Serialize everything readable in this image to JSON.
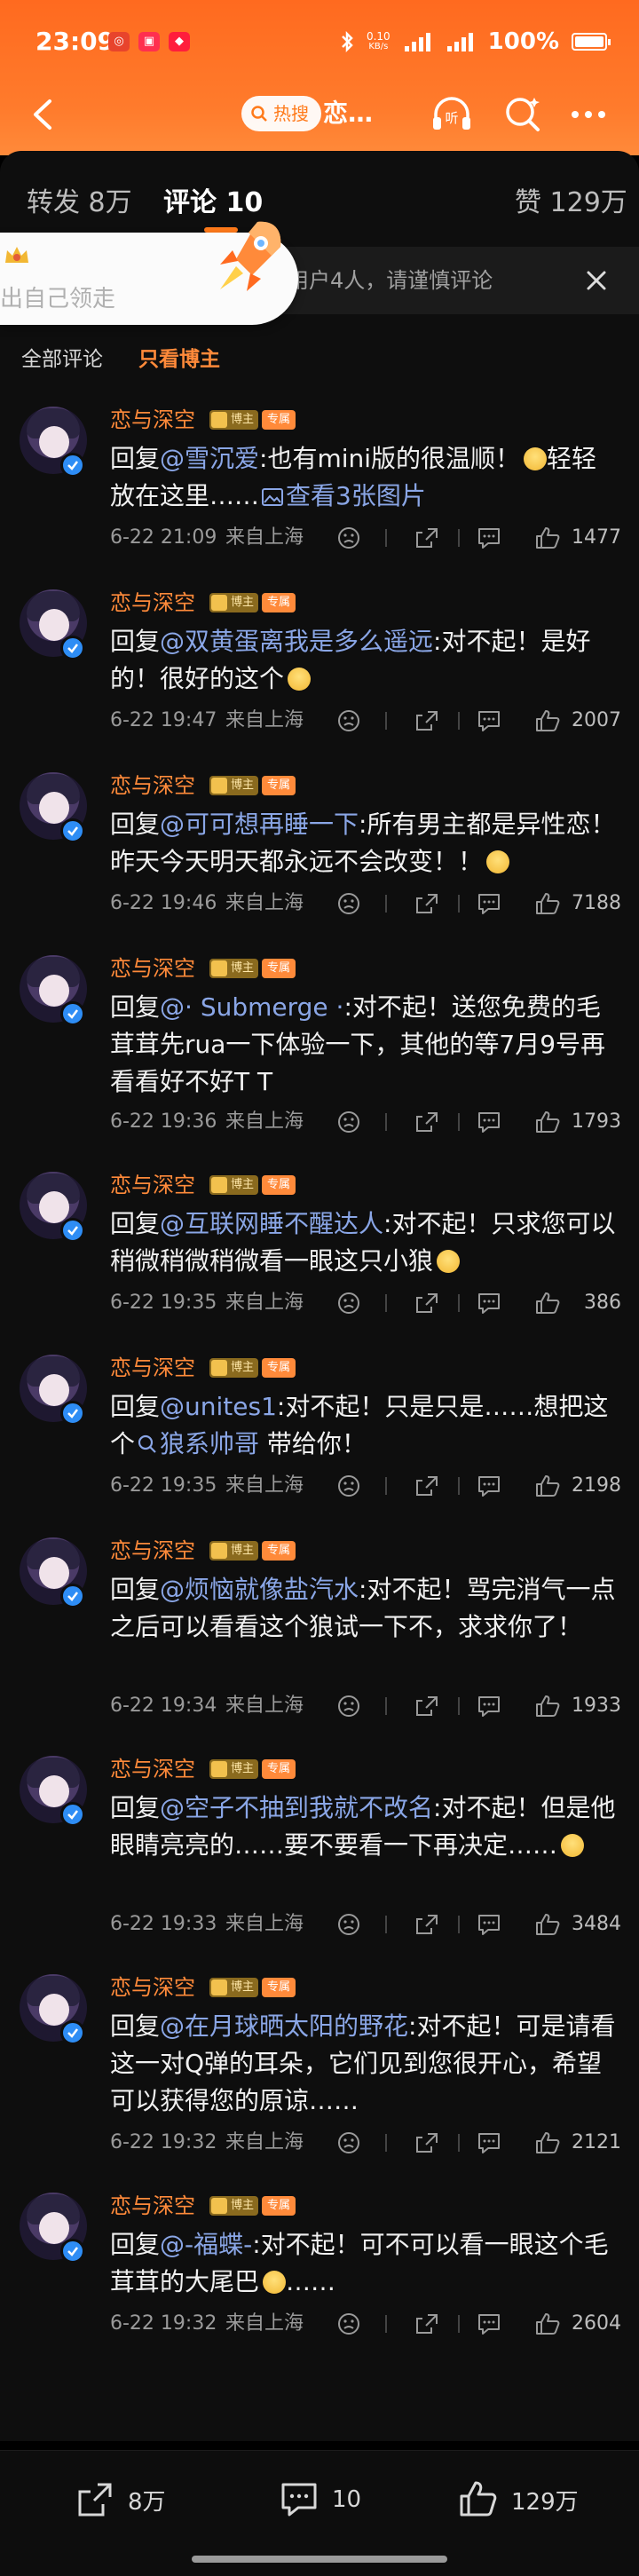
{
  "status_bar": {
    "time": "23:09",
    "net_speed_value": "0.10",
    "net_speed_unit": "KB/s",
    "signal1": "5G",
    "signal2": "5G",
    "battery": "100%"
  },
  "nav": {
    "hot_badge": "热搜",
    "topic": "恋…"
  },
  "tabs": {
    "repost": "转发 8万",
    "comments": "评论 10",
    "likes": "赞 129万"
  },
  "notice": {
    "text": "论用户4人，请谨慎评论"
  },
  "promo": {
    "text": "出自己领走"
  },
  "filters": {
    "all": "全部评论",
    "owner_only": "只看博主"
  },
  "labels": {
    "reply_prefix": "回复",
    "location": "来自上海",
    "badge_boss": "博主",
    "badge_fan": "专属"
  },
  "comments": [
    {
      "user": "恋与深空",
      "mention": "@雪沉爱",
      "text": ":也有mini版的很温顺！",
      "text2": "轻轻放在这里……",
      "pic_link": "查看3张图片",
      "date": "6-22 21:09",
      "likes": "1477"
    },
    {
      "user": "恋与深空",
      "mention": "@双黄蛋离我是多么遥远",
      "text": ":对不起！是好的！很好的这个",
      "date": "6-22 19:47",
      "likes": "2007"
    },
    {
      "user": "恋与深空",
      "mention": "@可可想再睡一下",
      "text": ":所有男主都是异性恋！昨天今天明天都永远不会改变！！",
      "date": "6-22 19:46",
      "likes": "7188"
    },
    {
      "user": "恋与深空",
      "mention": "@· Submerge ·",
      "text": ":对不起！送您免费的毛茸茸先rua一下体验一下，其他的等7月9号再看看好不好T T",
      "date": "6-22 19:36",
      "likes": "1793"
    },
    {
      "user": "恋与深空",
      "mention": "@互联网睡不醒达人",
      "text": ":对不起！只求您可以稍微稍微稍微看一眼这只小狼",
      "date": "6-22 19:35",
      "likes": "386"
    },
    {
      "user": "恋与深空",
      "mention": "@unites1",
      "text": ":对不起！只是只是……想把这个",
      "search_link": "狼系帅哥",
      "text2": " 带给你！",
      "date": "6-22 19:35",
      "likes": "2198"
    },
    {
      "user": "恋与深空",
      "mention": "@烦恼就像盐汽水",
      "text": ":对不起！骂完消气一点之后可以看看这个狼试一下不，求求你了！",
      "date": "6-22 19:34",
      "likes": "1933"
    },
    {
      "user": "恋与深空",
      "mention": "@空子不抽到我就不改名",
      "text": ":对不起！但是他眼睛亮亮的……要不要看一下再决定……",
      "date": "6-22 19:33",
      "likes": "3484"
    },
    {
      "user": "恋与深空",
      "mention": "@在月球晒太阳的野花",
      "text": ":对不起！可是请看这一对Q弹的耳朵，它们见到您很开心，希望可以获得您的原谅……",
      "date": "6-22 19:32",
      "likes": "2121"
    },
    {
      "user": "恋与深空",
      "mention": "@-福蝶-",
      "text": ":对不起！可不可以看一眼这个毛茸茸的大尾巴",
      "text2": "……",
      "date": "6-22 19:32",
      "likes": "2604"
    }
  ],
  "bottom_bar": {
    "repost": "8万",
    "comments": "10",
    "likes": "129万"
  },
  "colors": {
    "header_orange": "#ff6a1f",
    "accent": "#ff8a3a",
    "mention_blue": "#8aa6e6",
    "background": "#000000"
  }
}
